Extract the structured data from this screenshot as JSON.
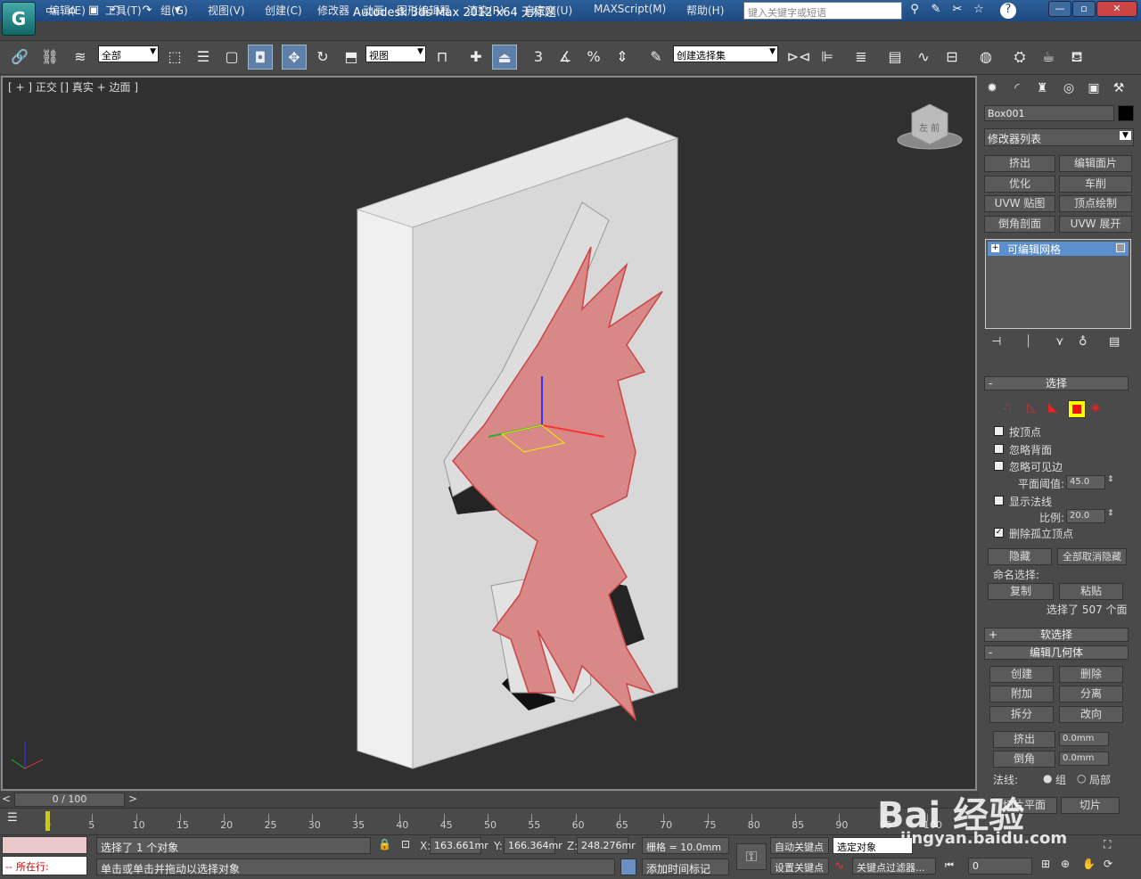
{
  "window": {
    "title": "Autodesk 3ds Max  2012 x64      无标题",
    "search_placeholder": "键入关键字或短语",
    "min": "—",
    "max": "▫",
    "close": "✕",
    "help": "?"
  },
  "menu": [
    "编辑(E)",
    "工具(T)",
    "组(G)",
    "视图(V)",
    "创建(C)",
    "修改器",
    "动画",
    "图形编辑器",
    "渲染(R)",
    "自定义(U)",
    "MAXScript(M)",
    "帮助(H)"
  ],
  "toolbar": {
    "filter": "全部",
    "ref_coord": "视图",
    "selection_set": "创建选择集",
    "snap_3": "3",
    "snap_pct": "%"
  },
  "viewport": {
    "label": "[ + ] 正交 [] 真实 + 边面 ]",
    "viewcube_face": "左 前"
  },
  "panel": {
    "object_name": "Box001",
    "color": "#000000",
    "modifier_list": "修改器列表",
    "mod_buttons": [
      "挤出",
      "编辑面片",
      "优化",
      "车削",
      "UVW 贴图",
      "顶点绘制",
      "倒角剖面",
      "UVW 展开"
    ],
    "stack_item": "可编辑网格",
    "selection": {
      "title": "选择",
      "by_vertex": "按顶点",
      "ignore_back": "忽略背面",
      "ignore_visible": "忽略可见边",
      "planar_label": "平面阈值:",
      "planar_value": "45.0",
      "show_normals": "显示法线",
      "scale_label": "比例:",
      "scale_value": "20.0",
      "delete_iso": "删除孤立顶点",
      "hide": "隐藏",
      "unhide_all": "全部取消隐藏",
      "named_sel": "命名选择:",
      "copy": "复制",
      "paste": "粘贴",
      "selected_info": "选择了 507 个面"
    },
    "soft_sel": "软选择",
    "edit_geom": {
      "title": "编辑几何体",
      "create": "创建",
      "delete": "删除",
      "attach": "附加",
      "detach": "分离",
      "split": "拆分",
      "turn": "改向",
      "extrude": "挤出",
      "extrude_val": "0.0mm",
      "bevel": "倒角",
      "bevel_val": "0.0mm",
      "normal_label": "法线:",
      "group": "组",
      "local": "局部",
      "slice_plane": "切片平面",
      "slice": "切片"
    }
  },
  "timeline": {
    "frame": "0 / 100",
    "ticks": [
      "0",
      "5",
      "10",
      "15",
      "20",
      "25",
      "30",
      "35",
      "40",
      "45",
      "50",
      "55",
      "60",
      "65",
      "70",
      "75",
      "80",
      "85",
      "90",
      "95",
      "100"
    ]
  },
  "status": {
    "maxscript": "所在行:",
    "selected": "选择了 1 个对象",
    "prompt": "单击或单击并拖动以选择对象",
    "x": "163.661mr",
    "y": "166.364mr",
    "z": "248.276mr",
    "grid": "栅格 = 10.0mm",
    "autokey": "自动关键点",
    "setkey": "设置关键点",
    "sel_obj": "选定对象",
    "add_time": "添加时间标记",
    "key_filter": "关键点过滤器...",
    "frame_input": "0"
  },
  "watermark": {
    "brand": "Bai 经验",
    "url": "jingyan.baidu.com"
  }
}
